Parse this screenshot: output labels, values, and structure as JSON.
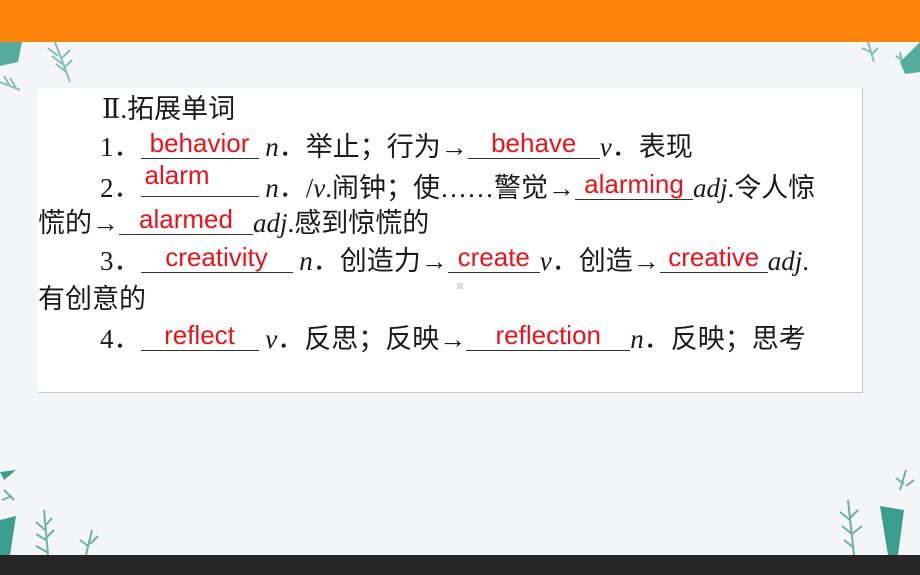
{
  "slide": {
    "heading": "Ⅱ.拓展单词",
    "items": [
      {
        "num": "1．",
        "answers": [
          "behavior",
          "behave"
        ],
        "pos1": "n",
        "def1": "．举止；行为→",
        "pos2": "v",
        "def2": "．表现"
      },
      {
        "num": "2．",
        "answers": [
          "alarm",
          "alarming",
          "alarmed"
        ],
        "pos1": "n",
        "def1a": "．/",
        "pos1b": "v",
        "def1b": ".闹钟；使……警觉→",
        "pos2": "adj",
        "def2": ".令人惊",
        "cont": "慌的→",
        "pos3": "adj",
        "def3": ".感到惊慌的"
      },
      {
        "num": "3．",
        "answers": [
          "creativity",
          "create",
          "creative"
        ],
        "pos1": "n",
        "def1": "．创造力→",
        "pos2": "v",
        "def2": "．创造→",
        "pos3": "adj",
        "def3": ".",
        "cont": "有创意的"
      },
      {
        "num": "4．",
        "answers": [
          "reflect",
          "reflection"
        ],
        "pos1": "v",
        "def1": "．反思；反映→",
        "pos2": "n",
        "def2": "．反映；思考"
      }
    ]
  },
  "colors": {
    "top_bar": "#fe850b",
    "bottom_bar": "#262626",
    "answer": "#e8141b",
    "leaf": "#3a9e8c"
  }
}
